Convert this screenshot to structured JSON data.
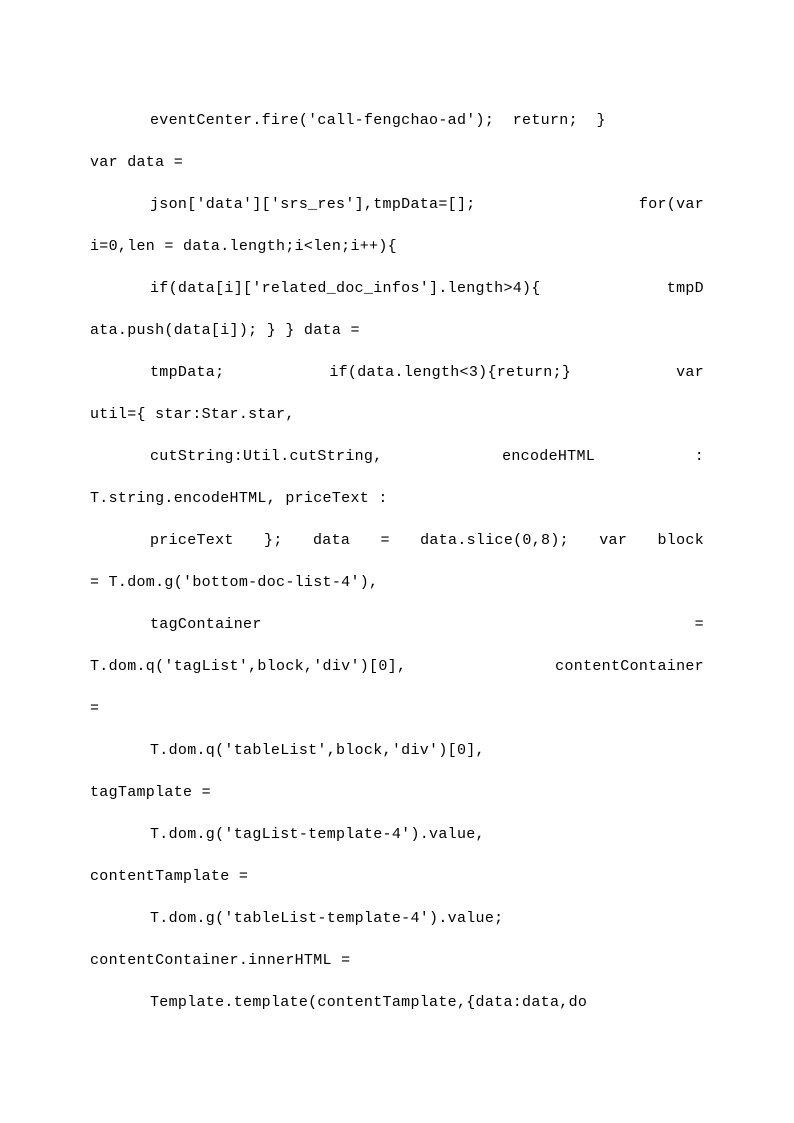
{
  "lines": [
    {
      "text": "eventCenter.fire('call-fengchao-ad');  return;  }",
      "cls": "code-line indent left"
    },
    {
      "text": "var data =",
      "cls": "code-line no-indent left"
    },
    {
      "text": "json['data']['srs_res'],tmpData=[];     for(var",
      "cls": "code-line indent"
    },
    {
      "text": "i=0,len = data.length;i<len;i++){",
      "cls": "code-line no-indent left"
    },
    {
      "text": "if(data[i]['related_doc_infos'].length>4){  tmpD",
      "cls": "code-line indent"
    },
    {
      "text": "ata.push(data[i]); } } data =",
      "cls": "code-line no-indent left"
    },
    {
      "text": "tmpData;     if(data.length<3){return;}     var",
      "cls": "code-line indent"
    },
    {
      "text": "util={ star:Star.star,",
      "cls": "code-line no-indent left"
    },
    {
      "text": "cutString:Util.cutString,      encodeHTML     :",
      "cls": "code-line indent"
    },
    {
      "text": "T.string.encodeHTML, priceText :",
      "cls": "code-line no-indent left"
    },
    {
      "text": "priceText }; data = data.slice(0,8); var block",
      "cls": "code-line indent"
    },
    {
      "text": "= T.dom.g('bottom-doc-list-4'),",
      "cls": "code-line no-indent left"
    },
    {
      "text": "tagContainer                                   =",
      "cls": "code-line indent"
    },
    {
      "text": "T.dom.q('tagList',block,'div')[0],  contentContainer",
      "cls": "code-line no-indent"
    },
    {
      "text": "=",
      "cls": "code-line no-indent left"
    },
    {
      "text": "T.dom.q('tableList',block,'div')[0],",
      "cls": "code-line indent left"
    },
    {
      "text": "tagTamplate =",
      "cls": "code-line no-indent left"
    },
    {
      "text": "T.dom.g('tagList-template-4').value,",
      "cls": "code-line indent left"
    },
    {
      "text": "contentTamplate =",
      "cls": "code-line no-indent left"
    },
    {
      "text": "T.dom.g('tableList-template-4').value;",
      "cls": "code-line indent left"
    },
    {
      "text": "contentContainer.innerHTML =",
      "cls": "code-line no-indent left"
    },
    {
      "text": "Template.template(contentTamplate,{data:data,do",
      "cls": "code-line indent left"
    }
  ]
}
